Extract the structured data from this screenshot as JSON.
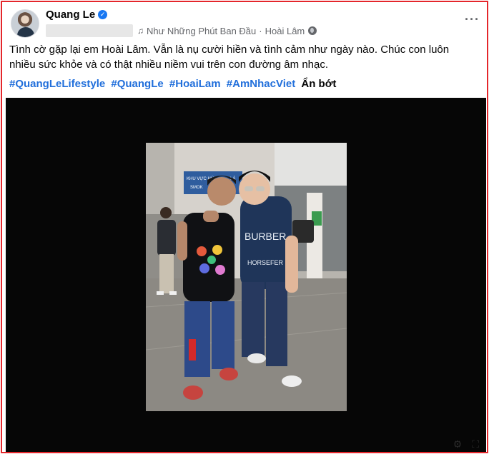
{
  "post": {
    "author": "Quang Le",
    "song": "Như Những Phút Ban Đầu",
    "separator": "·",
    "artist": "Hoài Lâm",
    "text": "Tình cờ gặp lại em Hoài Lâm. Vẫn là nụ cười hiền và tình cảm như ngày nào. Chúc con luôn nhiều sức khỏe và có thật nhiều niềm vui trên con đường âm nhạc.",
    "hashtags": [
      "#QuangLeLifestyle",
      "#QuangLe",
      "#HoaiLam",
      "#AmNhacViet"
    ],
    "see_less": "Ẩn bớt"
  },
  "photo": {
    "sign_line1": "KHU VỰC HÚT",
    "sign_line1b": "LÁ",
    "sign_line2": "SMOK",
    "shirt_text1": "BURBER",
    "shirt_text2": "HORSEFER"
  },
  "icons": {
    "verified": "verified-badge-icon",
    "music": "music-note-icon",
    "privacy": "globe-icon",
    "more": "more-options-icon"
  },
  "colors": {
    "frame_border": "#e4262b",
    "link": "#216fdb",
    "verified": "#1877f2",
    "media_bg": "#060606"
  }
}
